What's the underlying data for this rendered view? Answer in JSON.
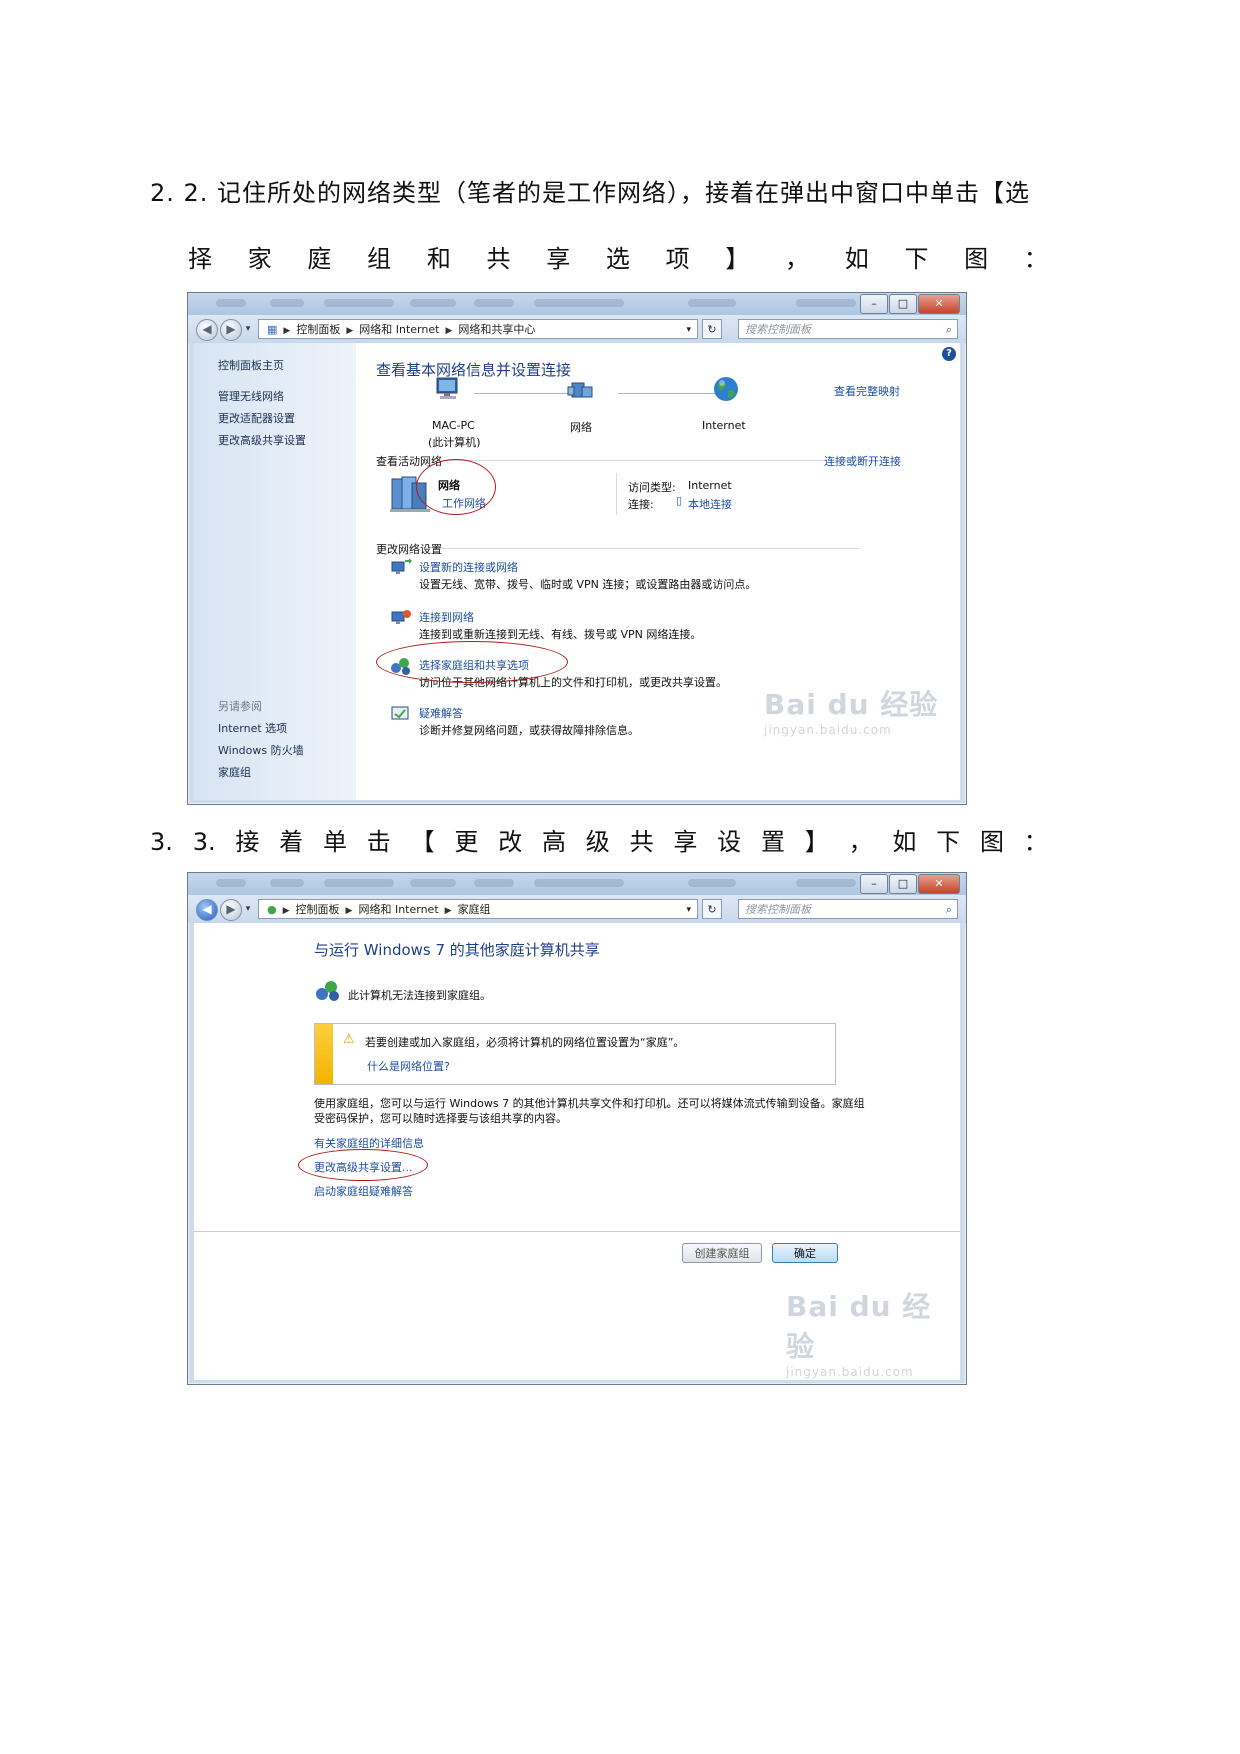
{
  "steps": [
    {
      "line1": "2.  2. 记住所处的网络类型（笔者的是工作网络），接着在弹出中窗口中单击【选",
      "line2": [
        "择",
        "家",
        "庭",
        "组",
        "和",
        "共",
        "享",
        "选",
        "项",
        "】",
        "，",
        "如",
        "下",
        "图",
        "："
      ]
    },
    {
      "line1_chars": [
        "3.",
        "3.",
        "接",
        "着",
        "单",
        "击",
        "【",
        "更",
        "改",
        "高",
        "级",
        "共",
        "享",
        "设",
        "置",
        "】",
        "，",
        "如",
        "下",
        "图",
        "："
      ]
    }
  ],
  "window1": {
    "breadcrumb": [
      "控制面板",
      "网络和 Internet",
      "网络和共享中心"
    ],
    "search_placeholder": "搜索控制面板",
    "sidebar": {
      "home": "控制面板主页",
      "items": [
        "管理无线网络",
        "更改适配器设置",
        "更改高级共享设置"
      ],
      "see_also": "另请参阅",
      "see_also_items": [
        "Internet 选项",
        "Windows 防火墙",
        "家庭组"
      ]
    },
    "title": "查看基本网络信息并设置连接",
    "map_link": "查看完整映射",
    "nodes": {
      "pc": "MAC-PC",
      "pc_sub": "(此计算机)",
      "network": "网络",
      "internet": "Internet"
    },
    "active_label": "查看活动网络",
    "connect_link": "连接或断开连接",
    "active_network_name": "网络",
    "active_network_type": "工作网络",
    "access_type_label": "访问类型:",
    "access_type_value": "Internet",
    "connection_label": "连接:",
    "connection_value": "本地连接",
    "change_label": "更改网络设置",
    "tasks": [
      {
        "title": "设置新的连接或网络",
        "desc": "设置无线、宽带、拨号、临时或 VPN 连接；或设置路由器或访问点。"
      },
      {
        "title": "连接到网络",
        "desc": "连接到或重新连接到无线、有线、拨号或 VPN 网络连接。"
      },
      {
        "title": "选择家庭组和共享选项",
        "desc": "访问位于其他网络计算机上的文件和打印机，或更改共享设置。"
      },
      {
        "title": "疑难解答",
        "desc": "诊断并修复网络问题，或获得故障排除信息。"
      }
    ]
  },
  "window2": {
    "breadcrumb": [
      "控制面板",
      "网络和 Internet",
      "家庭组"
    ],
    "search_placeholder": "搜索控制面板",
    "title": "与运行 Windows 7 的其他家庭计算机共享",
    "status": "此计算机无法连接到家庭组。",
    "warning": "若要创建或加入家庭组，必须将计算机的网络位置设置为“家庭”。",
    "warning_link": "什么是网络位置?",
    "desc_line1": "使用家庭组，您可以与运行 Windows 7 的其他计算机共享文件和打印机。还可以将媒体流式传输到设备。家庭组",
    "desc_line2": "受密码保护，您可以随时选择要与该组共享的内容。",
    "links": [
      "有关家庭组的详细信息",
      "更改高级共享设置...",
      "启动家庭组疑难解答"
    ],
    "btn_create": "创建家庭组",
    "btn_ok": "确定"
  },
  "watermark": {
    "brand": "Bai du 经验",
    "url": "jingyan.baidu.com"
  },
  "colors": {
    "link": "#1e4fa0",
    "heading": "#1e3f8a",
    "annotation": "#b01b1b",
    "warning": "#f4b400"
  }
}
